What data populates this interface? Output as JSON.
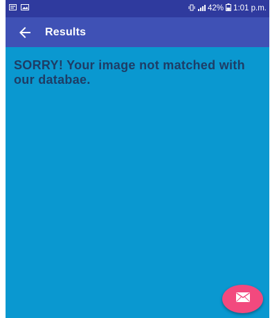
{
  "status_bar": {
    "battery": "42%",
    "time": "1:01 p.m."
  },
  "app_bar": {
    "title": "Results"
  },
  "content": {
    "message": "SORRY! Your image not matched with our databae."
  },
  "colors": {
    "status_bar_bg": "#2f3a9e",
    "app_bar_bg": "#3f51b5",
    "content_bg": "#0a98d0",
    "message_text": "#1e3d66",
    "fab_bg": "#f2497e"
  },
  "icons": {
    "back": "arrow-left",
    "fab": "envelope"
  }
}
